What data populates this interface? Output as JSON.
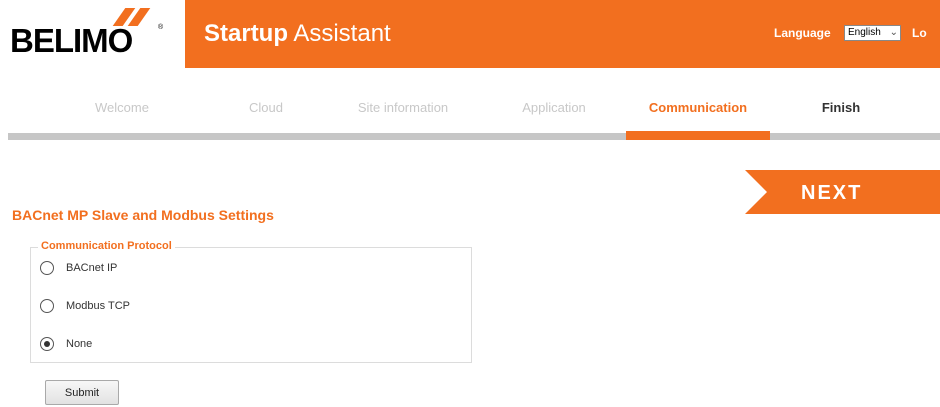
{
  "brand": {
    "logo_text": "BELIMO",
    "logo_mark": "®",
    "accent_color": "#f26f1f"
  },
  "header": {
    "title_bold": "Startup",
    "title_rest": "Assistant",
    "language_label": "Language",
    "language_value": "English",
    "logout_truncated": "Lo"
  },
  "steps": [
    {
      "label": "Welcome",
      "state": "done"
    },
    {
      "label": "Cloud",
      "state": "done"
    },
    {
      "label": "Site information",
      "state": "done"
    },
    {
      "label": "Application",
      "state": "done"
    },
    {
      "label": "Communication",
      "state": "active"
    },
    {
      "label": "Finish",
      "state": "upcoming"
    }
  ],
  "next_button": {
    "label": "NEXT"
  },
  "section": {
    "title": "BACnet MP Slave and Modbus Settings",
    "fieldset_legend": "Communication Protocol",
    "options": [
      {
        "label": "BACnet IP",
        "checked": false
      },
      {
        "label": "Modbus TCP",
        "checked": false
      },
      {
        "label": "None",
        "checked": true
      }
    ],
    "submit_label": "Submit"
  }
}
